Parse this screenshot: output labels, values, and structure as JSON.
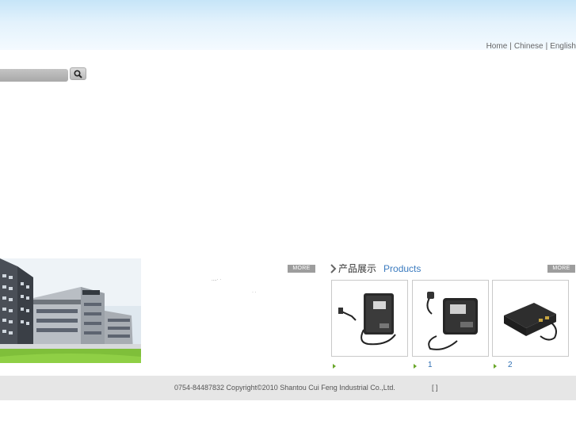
{
  "header": {
    "links": [
      {
        "label": "Home"
      },
      {
        "label": "Chinese"
      },
      {
        "label": "English"
      }
    ],
    "separator": "|"
  },
  "search": {
    "placeholder": "",
    "button_icon": "search-icon"
  },
  "about": {
    "more_label": "MORE",
    "fragment_1": "....· ·",
    "fragment_2": "·  ·"
  },
  "products": {
    "title_cn": "产品展示",
    "title_en": "Products",
    "more_label": "MORE",
    "items": [
      {
        "name": "",
        "icon": "power-adapter-image"
      },
      {
        "name": "1",
        "icon": "power-adapter-image"
      },
      {
        "name": "2",
        "icon": "power-adapter-image"
      }
    ]
  },
  "footer": {
    "copyright": "0754-84487832 Copyright©2010 Shantou Cui Feng Industrial Co.,Ltd.",
    "bracket": "[   ]"
  },
  "colors": {
    "header_top": "#c6e5f8",
    "accent_blue": "#3b7bbf",
    "bullet_green": "#6aa72a",
    "more_grey": "#9d9d9d",
    "footer_bg": "#e6e6e6"
  }
}
